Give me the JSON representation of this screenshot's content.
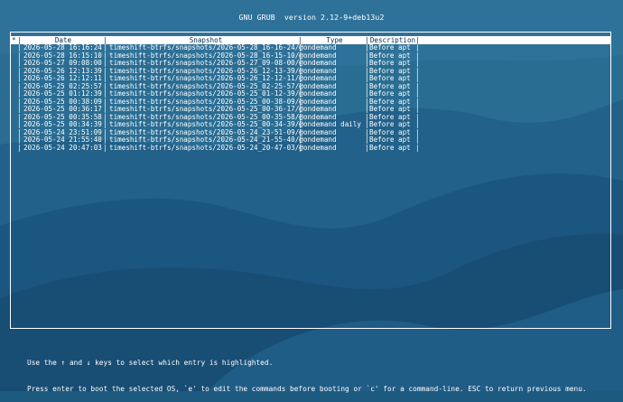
{
  "header": {
    "title": "GNU GRUB  version 2.12-9+deb13u2"
  },
  "table": {
    "columns": {
      "marker": "*",
      "date": "Date",
      "snapshot": "Snapshot",
      "type": "Type",
      "description": "Description"
    },
    "rows": [
      {
        "date": "2026-05-28 16:16:24",
        "snapshot": "timeshift-btrfs/snapshots/2026-05-28_16-16-24/@",
        "type": "ondemand",
        "description": "Before apt"
      },
      {
        "date": "2026-05-28 16:15:10",
        "snapshot": "timeshift-btrfs/snapshots/2026-05-28_16-15-10/@",
        "type": "ondemand",
        "description": "Before apt"
      },
      {
        "date": "2026-05-27 09:08:00",
        "snapshot": "timeshift-btrfs/snapshots/2026-05-27_09-08-00/@",
        "type": "ondemand",
        "description": "Before apt"
      },
      {
        "date": "2026-05-26 12:13:39",
        "snapshot": "timeshift-btrfs/snapshots/2026-05-26_12-13-39/@",
        "type": "ondemand",
        "description": "Before apt"
      },
      {
        "date": "2026-05-26 12:12:11",
        "snapshot": "timeshift-btrfs/snapshots/2026-05-26_12-12-11/@",
        "type": "ondemand",
        "description": "Before apt"
      },
      {
        "date": "2026-05-25 02:25:57",
        "snapshot": "timeshift-btrfs/snapshots/2026-05-25_02-25-57/@",
        "type": "ondemand",
        "description": "Before apt"
      },
      {
        "date": "2026-05-25 01:12:39",
        "snapshot": "timeshift-btrfs/snapshots/2026-05-25_01-12-39/@",
        "type": "ondemand",
        "description": "Before apt"
      },
      {
        "date": "2026-05-25 00:38:09",
        "snapshot": "timeshift-btrfs/snapshots/2026-05-25_00-38-09/@",
        "type": "ondemand",
        "description": "Before apt"
      },
      {
        "date": "2026-05-25 00:36:17",
        "snapshot": "timeshift-btrfs/snapshots/2026-05-25_00-36-17/@",
        "type": "ondemand",
        "description": "Before apt"
      },
      {
        "date": "2026-05-25 00:35:58",
        "snapshot": "timeshift-btrfs/snapshots/2026-05-25_00-35-58/@",
        "type": "ondemand",
        "description": "Before apt"
      },
      {
        "date": "2026-05-25 00:34:39",
        "snapshot": "timeshift-btrfs/snapshots/2026-05-25_00-34-39/@",
        "type": "ondemand daily",
        "description": "Before apt"
      },
      {
        "date": "2026-05-24 23:51:09",
        "snapshot": "timeshift-btrfs/snapshots/2026-05-24_23-51-09/@",
        "type": "ondemand",
        "description": "Before apt"
      },
      {
        "date": "2026-05-24 21:55:40",
        "snapshot": "timeshift-btrfs/snapshots/2026-05-24_21-55-40/@",
        "type": "ondemand",
        "description": "Before apt"
      },
      {
        "date": "2026-05-24 20:47:03",
        "snapshot": "timeshift-btrfs/snapshots/2026-05-24_20-47-03/@",
        "type": "ondemand",
        "description": "Before apt"
      }
    ]
  },
  "footer": {
    "line1": "Use the ↑ and ↓ keys to select which entry is highlighted.",
    "line2": "Press enter to boot the selected OS, `e' to edit the commands before booting or `c' for a command-line. ESC to return previous menu."
  },
  "colors": {
    "background": "#1c5a80",
    "text": "#ffffff",
    "highlight_text": "#0a2b44"
  }
}
